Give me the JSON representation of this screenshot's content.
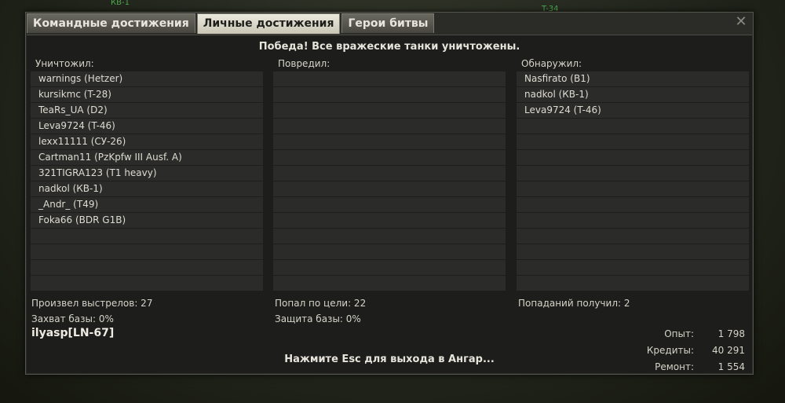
{
  "background": {
    "labels": [
      "КВ-1",
      "T-34"
    ]
  },
  "tabs": [
    {
      "label": "Командные достижения"
    },
    {
      "label": "Личные достижения"
    },
    {
      "label": "Герои битвы"
    }
  ],
  "close_symbol": "✕",
  "title": "Победа! Все вражеские танки уничтожены.",
  "columns": {
    "destroyed": {
      "header": "Уничтожил:",
      "items": [
        "warnings (Hetzer)",
        "kursikmc (T-28)",
        "TeaRs_UA (D2)",
        "Leva9724 (T-46)",
        "lexx11111 (СУ-26)",
        "Cartman11 (PzKpfw III Ausf. A)",
        "321TIGRA123 (T1 heavy)",
        "nadkol (КВ-1)",
        "_Andr_ (T49)",
        "Foka66 (BDR G1B)"
      ]
    },
    "damaged": {
      "header": "Повредил:",
      "items": []
    },
    "spotted": {
      "header": "Обнаружил:",
      "items": [
        "Nasfirato (B1)",
        "nadkol (КВ-1)",
        "Leva9724 (T-46)"
      ]
    }
  },
  "stats": {
    "shots": "Произвел выстрелов: 27",
    "capture": "Захват базы: 0%",
    "hits": "Попал по цели: 22",
    "defense": "Защита базы: 0%",
    "received": "Попаданий получил: 2"
  },
  "player": "ilyasp[LN-67]",
  "esc_hint": "Нажмите Esc для выхода в Ангар...",
  "summary": [
    {
      "label": "Опыт:",
      "value": "1 798"
    },
    {
      "label": "Кредиты:",
      "value": "40 291"
    },
    {
      "label": "Ремонт:",
      "value": "1 554"
    }
  ]
}
